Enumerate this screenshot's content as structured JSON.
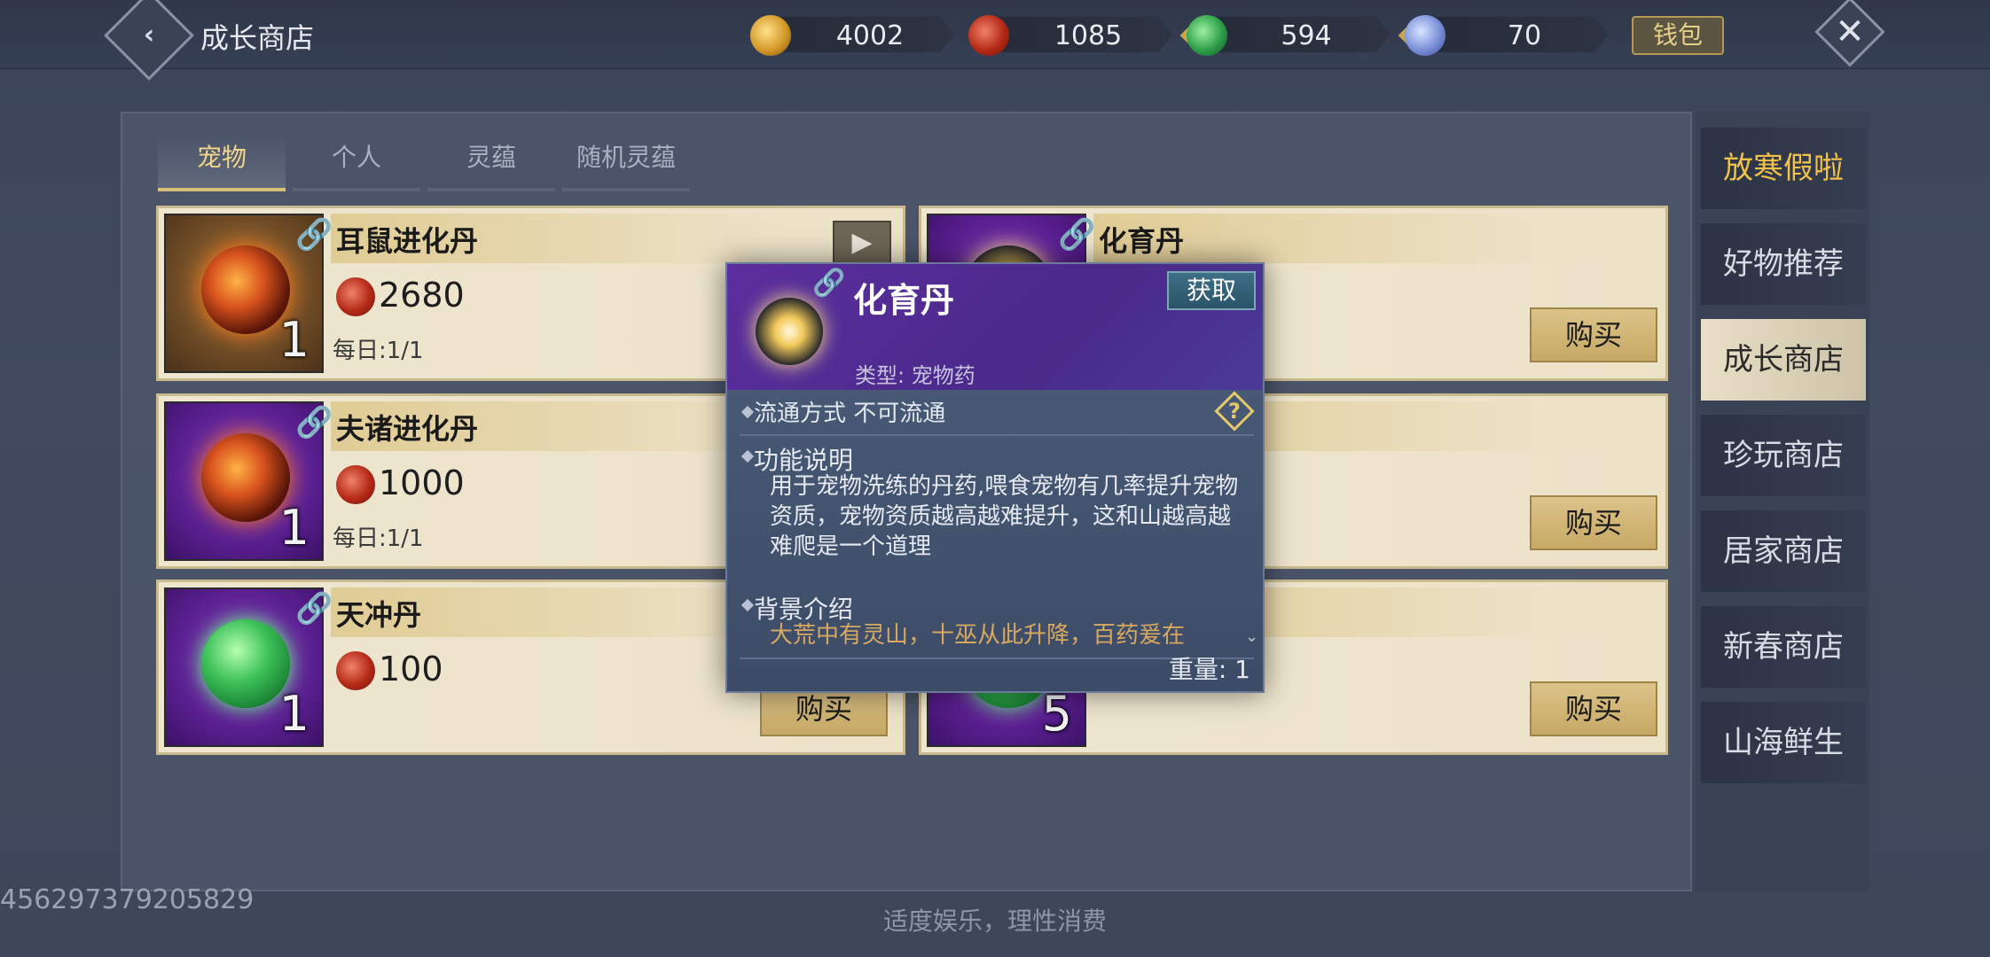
{
  "header": {
    "title": "成长商店",
    "currencies": [
      {
        "icon": "gold-coin-icon",
        "value": "4002",
        "plus": false
      },
      {
        "icon": "red-spiral-coin-icon",
        "value": "1085",
        "plus": true
      },
      {
        "icon": "jade-icon",
        "value": "594",
        "plus": true
      },
      {
        "icon": "crystal-icon",
        "value": "70",
        "plus": false
      }
    ],
    "wallet_label": "钱包",
    "plus_glyph": "+"
  },
  "tabs": [
    {
      "label": "宠物",
      "active": true
    },
    {
      "label": "个人",
      "active": false
    },
    {
      "label": "灵蕴",
      "active": false
    },
    {
      "label": "随机灵蕴",
      "active": false
    }
  ],
  "items": [
    {
      "name": "耳鼠进化丹",
      "price": "2680",
      "daily": "每日:1/1",
      "count": "1",
      "thumb": "orange",
      "orb": "fire",
      "buy_label": "",
      "video": true
    },
    {
      "name": "化育丹",
      "price": "",
      "daily": "",
      "count": "",
      "thumb": "purple",
      "orb": "sun",
      "buy_label": "购买",
      "video": false
    },
    {
      "name": "夫诸进化丹",
      "price": "1000",
      "daily": "每日:1/1",
      "count": "1",
      "thumb": "purple",
      "orb": "fire",
      "buy_label": "",
      "video": false
    },
    {
      "name": "",
      "price": "",
      "daily": "",
      "count": "",
      "thumb": "purple",
      "orb": "",
      "buy_label": "购买",
      "video": false
    },
    {
      "name": "天冲丹",
      "price": "100",
      "daily": "",
      "count": "1",
      "thumb": "purple",
      "orb": "green",
      "buy_label": "购买",
      "video": false
    },
    {
      "name": "",
      "price": "",
      "daily": "",
      "count": "5",
      "thumb": "purple",
      "orb": "green",
      "buy_label": "购买",
      "video": false
    }
  ],
  "side_menu": [
    {
      "label": "放寒假啦",
      "state": "promo"
    },
    {
      "label": "好物推荐",
      "state": ""
    },
    {
      "label": "成长商店",
      "state": "sel"
    },
    {
      "label": "珍玩商店",
      "state": ""
    },
    {
      "label": "居家商店",
      "state": ""
    },
    {
      "label": "新春商店",
      "state": ""
    },
    {
      "label": "山海鲜生",
      "state": ""
    }
  ],
  "popup": {
    "title": "化育丹",
    "get_label": "获取",
    "type_line": "类型: 宠物药",
    "circulation": "流通方式   不可流通",
    "help_glyph": "?",
    "func_head": "功能说明",
    "func_body": "用于宠物洗练的丹药,喂食宠物有几率提升宠物资质，宠物资质越高越难提升，这和山越高越难爬是一个道理",
    "bg_head": "背景介绍",
    "bg_body": "大荒中有灵山，十巫从此升降，百药爰在",
    "weight": "重量: 1"
  },
  "footer": "适度娱乐，理性消费",
  "uid": "456297379205829"
}
